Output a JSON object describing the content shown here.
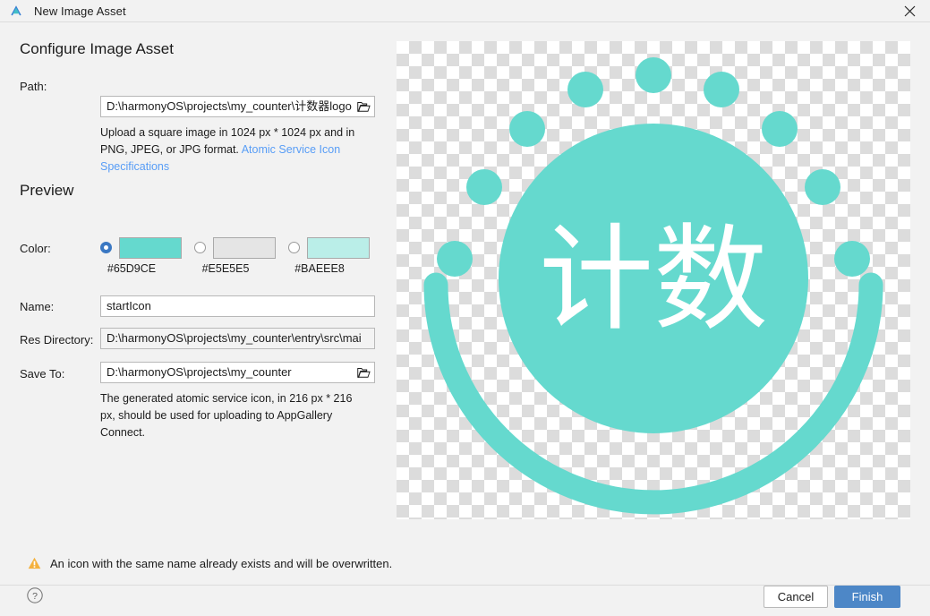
{
  "window": {
    "title": "New Image Asset",
    "app_icon": "deveco-studio-icon",
    "close_icon": "close-icon"
  },
  "sections": {
    "configure_title": "Configure Image Asset",
    "preview_title": "Preview"
  },
  "fields": {
    "path": {
      "label": "Path:",
      "value": "D:\\harmonyOS\\projects\\my_counter\\计数器logo",
      "browse_icon": "folder-open-icon"
    },
    "path_help": {
      "line1": "Upload a square image in 1024 px * 1024 px and in",
      "line2": "PNG, JPEG, or JPG format. ",
      "link": "Atomic Service Icon Specifications"
    },
    "color": {
      "label": "Color:",
      "options": [
        {
          "hex": "#65D9CE",
          "selected": true
        },
        {
          "hex": "#E5E5E5",
          "selected": false
        },
        {
          "hex": "#BAEEE8",
          "selected": false
        }
      ]
    },
    "name": {
      "label": "Name:",
      "value": "startIcon"
    },
    "res_directory": {
      "label": "Res Directory:",
      "value": "D:\\harmonyOS\\projects\\my_counter\\entry\\src\\mai"
    },
    "save_to": {
      "label": "Save To:",
      "value": "D:\\harmonyOS\\projects\\my_counter",
      "browse_icon": "folder-open-icon"
    },
    "save_help": {
      "line1": "The generated atomic service icon, in 216 px * 216",
      "line2": "px, should be used for uploading to AppGallery",
      "line3": "Connect."
    }
  },
  "preview": {
    "icon_text": "计数",
    "icon_color": "#65D9CE",
    "transparency_checker_light": "#FFFFFF",
    "transparency_checker_dark": "#DCDCDC"
  },
  "warning": {
    "icon": "warning-triangle-icon",
    "text": "An icon with the same name already exists and will be overwritten."
  },
  "footer": {
    "help_icon": "help-question-icon",
    "cancel_label": "Cancel",
    "finish_label": "Finish",
    "finish_color": "#4D87C7"
  }
}
